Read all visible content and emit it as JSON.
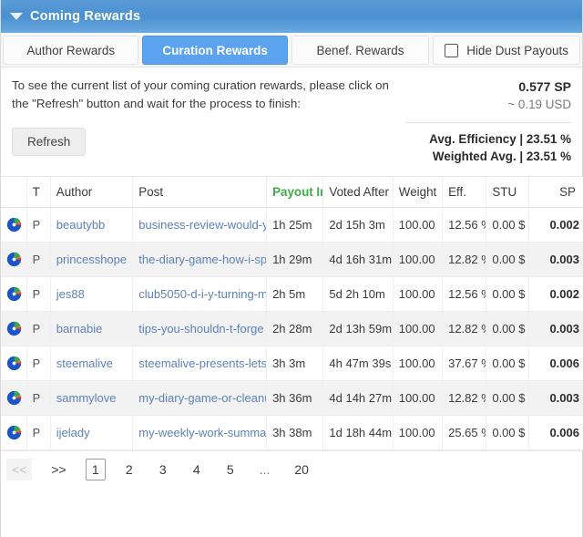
{
  "window": {
    "title": "Coming Rewards",
    "collapse_icon": "caret-down-icon"
  },
  "tabs": [
    {
      "label": "Author Rewards",
      "active": false
    },
    {
      "label": "Curation Rewards",
      "active": true
    },
    {
      "label": "Benef. Rewards",
      "active": false
    }
  ],
  "hide_dust": {
    "label": "Hide Dust Payouts",
    "checked": false
  },
  "info": {
    "text": "To see the current list of your coming curation rewards, please click on the \"Refresh\" button and wait for the process to finish:",
    "refresh_label": "Refresh"
  },
  "summary": {
    "sp_total": "0.577 SP",
    "usd_total": "~ 0.19 USD",
    "avg_efficiency": "Avg. Efficiency | 23.51 %",
    "weighted_avg": "Weighted Avg. | 23.51 %"
  },
  "table": {
    "headers": {
      "icon": "",
      "t": "T",
      "author": "Author",
      "post": "Post",
      "payout_in": "Payout In",
      "voted_after": "Voted After",
      "weight": "Weight",
      "eff": "Eff.",
      "stu": "STU",
      "sp": "SP"
    },
    "sorted_column": "payout_in",
    "sorted_color": "#3faa46",
    "rows": [
      {
        "icon": "pie-chart-icon",
        "t": "P",
        "author": "beautybb",
        "post": "business-review-would-y",
        "payout_in": "1h 25m",
        "voted_after": "2d 15h 3m",
        "weight": "100.00",
        "eff": "12.56 %",
        "stu": "0.00 $",
        "sp": "0.002"
      },
      {
        "icon": "pie-chart-icon",
        "t": "P",
        "author": "princesshope",
        "post": "the-diary-game-how-i-sp",
        "payout_in": "1h 29m",
        "voted_after": "4d 16h 31m",
        "weight": "100.00",
        "eff": "12.82 %",
        "stu": "0.00 $",
        "sp": "0.003"
      },
      {
        "icon": "pie-chart-icon",
        "t": "P",
        "author": "jes88",
        "post": "club5050-d-i-y-turning-m",
        "payout_in": "2h 5m",
        "voted_after": "5d 2h 10m",
        "weight": "100.00",
        "eff": "12.56 %",
        "stu": "0.00 $",
        "sp": "0.002"
      },
      {
        "icon": "pie-chart-icon",
        "t": "P",
        "author": "barnabie",
        "post": "tips-you-shouldn-t-forge",
        "payout_in": "2h 28m",
        "voted_after": "2d 13h 59m",
        "weight": "100.00",
        "eff": "12.82 %",
        "stu": "0.00 $",
        "sp": "0.003"
      },
      {
        "icon": "pie-chart-icon",
        "t": "P",
        "author": "steemalive",
        "post": "steemalive-presents-lets",
        "payout_in": "3h 3m",
        "voted_after": "4h 47m 39s",
        "weight": "100.00",
        "eff": "37.67 %",
        "stu": "0.00 $",
        "sp": "0.006"
      },
      {
        "icon": "pie-chart-icon",
        "t": "P",
        "author": "sammylove",
        "post": "my-diary-game-or-cleanu",
        "payout_in": "3h 36m",
        "voted_after": "4d 14h 27m",
        "weight": "100.00",
        "eff": "12.82 %",
        "stu": "0.00 $",
        "sp": "0.003"
      },
      {
        "icon": "pie-chart-icon",
        "t": "P",
        "author": "ijelady",
        "post": "my-weekly-work-summa",
        "payout_in": "3h 38m",
        "voted_after": "1d 18h 44m",
        "weight": "100.00",
        "eff": "25.65 %",
        "stu": "0.00 $",
        "sp": "0.006"
      }
    ]
  },
  "pagination": {
    "prev": "<<",
    "next": ">>",
    "pages": [
      "1",
      "2",
      "3",
      "4",
      "5",
      "...",
      "20"
    ],
    "current": "1"
  },
  "colors": {
    "accent": "#5ba3ef",
    "titlebar": "#4a90d0",
    "link": "#5b82b8",
    "sorted_header": "#3faa46"
  }
}
